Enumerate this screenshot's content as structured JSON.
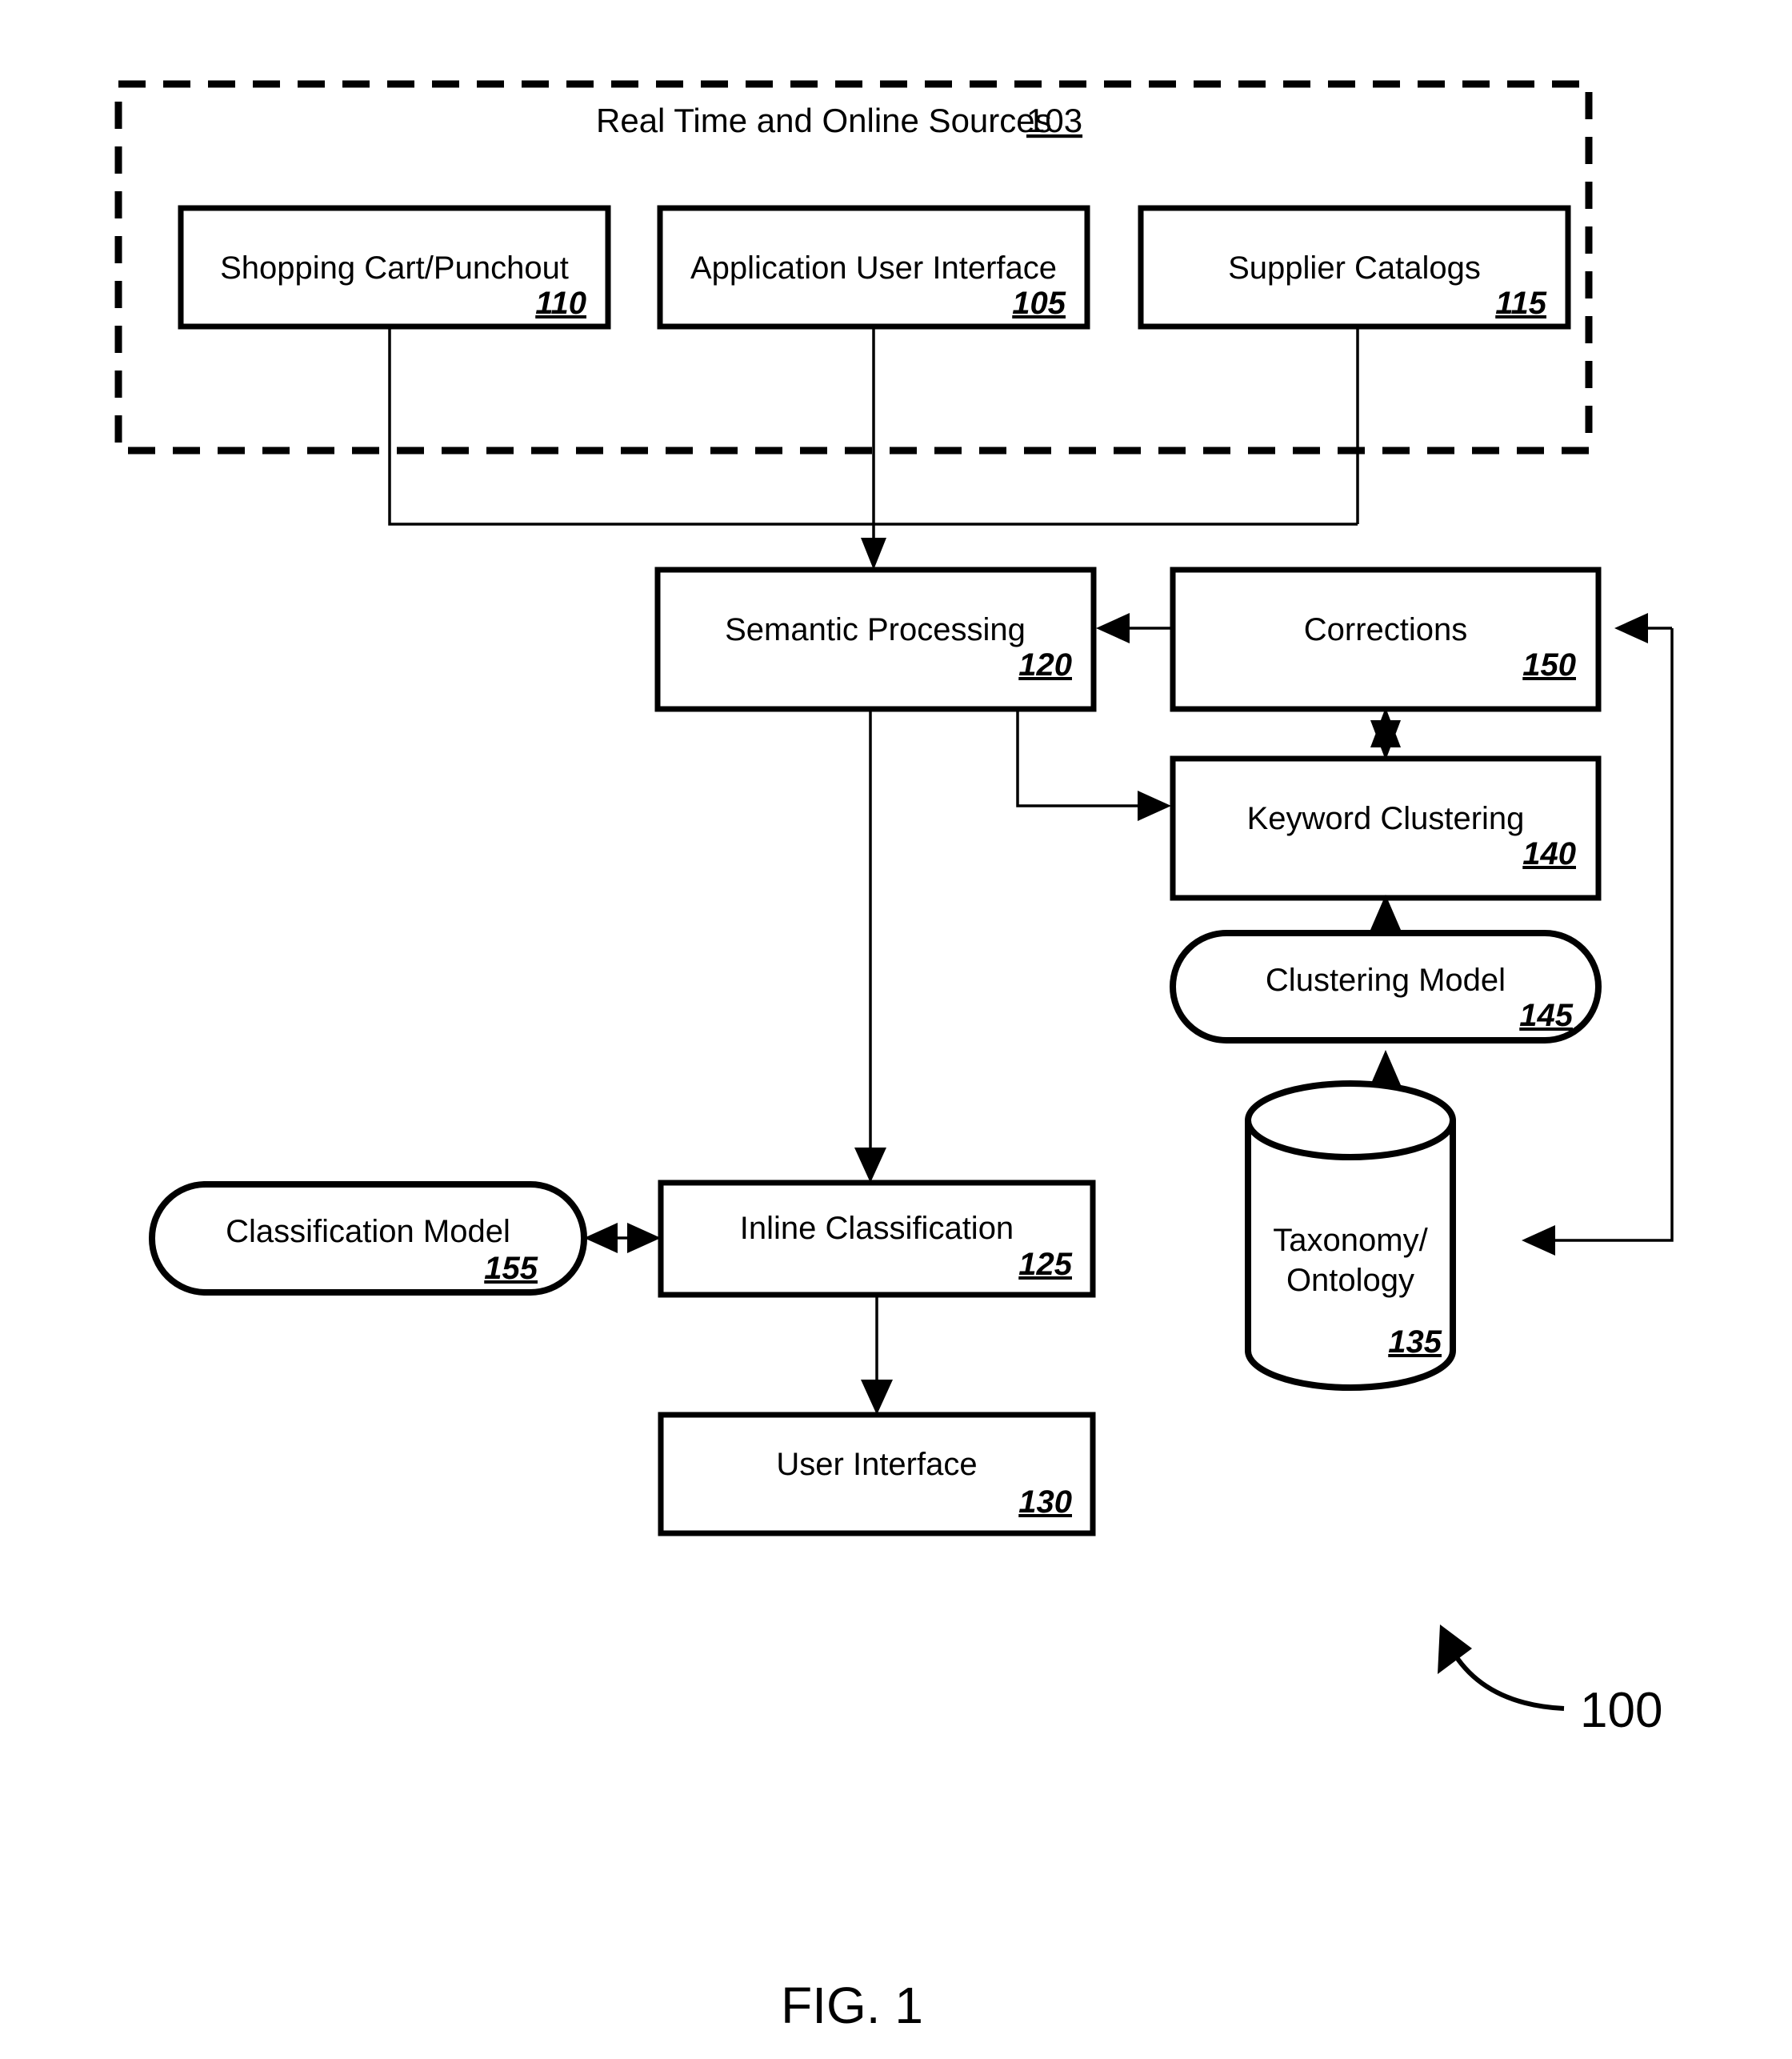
{
  "figure": {
    "caption": "FIG. 1",
    "system_ref": "100"
  },
  "container": {
    "title": "Real Time and Online Sources",
    "ref": "103",
    "style": "dashed"
  },
  "nodes": [
    {
      "id": "shopping-cart-punchout",
      "label": "Shopping Cart/Punchout",
      "ref": "110",
      "shape": "rect"
    },
    {
      "id": "application-user-interface",
      "label": "Application User Interface",
      "ref": "105",
      "shape": "rect"
    },
    {
      "id": "supplier-catalogs",
      "label": "Supplier Catalogs",
      "ref": "115",
      "shape": "rect"
    },
    {
      "id": "semantic-processing",
      "label": "Semantic Processing",
      "ref": "120",
      "shape": "rect"
    },
    {
      "id": "corrections",
      "label": "Corrections",
      "ref": "150",
      "shape": "rect"
    },
    {
      "id": "keyword-clustering",
      "label": "Keyword Clustering",
      "ref": "140",
      "shape": "rect"
    },
    {
      "id": "clustering-model",
      "label": "Clustering Model",
      "ref": "145",
      "shape": "stadium"
    },
    {
      "id": "taxonomy-ontology",
      "label_line1": "Taxonomy/",
      "label_line2": "Ontology",
      "ref": "135",
      "shape": "cylinder"
    },
    {
      "id": "classification-model",
      "label": "Classification Model",
      "ref": "155",
      "shape": "stadium"
    },
    {
      "id": "inline-classification",
      "label": "Inline Classification",
      "ref": "125",
      "shape": "rect"
    },
    {
      "id": "user-interface",
      "label": "User Interface",
      "ref": "130",
      "shape": "rect"
    }
  ],
  "edges": [
    {
      "from": "shopping-cart-punchout",
      "to": "semantic-processing",
      "arrow": "single"
    },
    {
      "from": "application-user-interface",
      "to": "semantic-processing",
      "arrow": "single"
    },
    {
      "from": "supplier-catalogs",
      "to": "semantic-processing",
      "arrow": "single"
    },
    {
      "from": "corrections",
      "to": "semantic-processing",
      "arrow": "single"
    },
    {
      "from": "semantic-processing",
      "to": "keyword-clustering",
      "arrow": "single"
    },
    {
      "from": "corrections",
      "to": "keyword-clustering",
      "arrow": "double"
    },
    {
      "from": "clustering-model",
      "to": "keyword-clustering",
      "arrow": "single"
    },
    {
      "from": "taxonomy-ontology",
      "to": "clustering-model",
      "arrow": "single"
    },
    {
      "from": "semantic-processing",
      "to": "inline-classification",
      "arrow": "single"
    },
    {
      "from": "classification-model",
      "to": "inline-classification",
      "arrow": "double"
    },
    {
      "from": "inline-classification",
      "to": "user-interface",
      "arrow": "single"
    },
    {
      "from": "feedback-bus",
      "to": "corrections",
      "arrow": "single"
    },
    {
      "from": "feedback-bus",
      "to": "taxonomy-ontology",
      "arrow": "single"
    }
  ],
  "colors": {
    "stroke": "#000000",
    "fill": "#ffffff",
    "background": "#ffffff"
  }
}
